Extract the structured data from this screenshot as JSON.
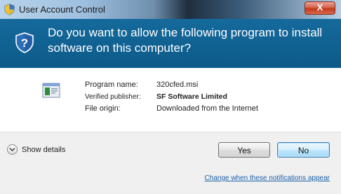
{
  "window": {
    "title": "User Account Control",
    "close_label": "X"
  },
  "header": {
    "question": "Do you want to allow the following program to install software on this computer?"
  },
  "details": {
    "program_name_label": "Program name:",
    "program_name_value": "320cfed.msi",
    "publisher_label": "Verified publisher:",
    "publisher_value": "SF Software Limited",
    "origin_label": "File origin:",
    "origin_value": "Downloaded from the Internet"
  },
  "footer": {
    "show_details_label": "Show details",
    "yes_label": "Yes",
    "no_label": "No",
    "notify_link": "Change when these notifications appear"
  },
  "colors": {
    "header_bg": "#0c5a89",
    "link": "#1a5fa8",
    "close_button": "#c2391c"
  },
  "icons": {
    "title": "uac-shield-icon",
    "header": "question-shield-icon",
    "program": "installer-package-icon",
    "details": "chevron-down-icon"
  }
}
